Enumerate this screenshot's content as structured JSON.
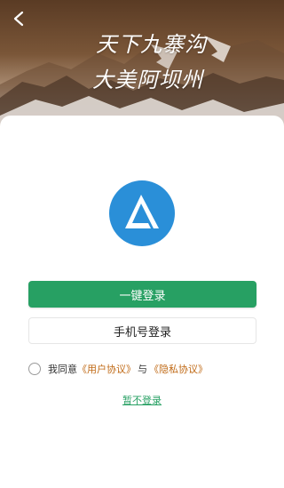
{
  "header": {
    "back_icon": "chevron-left-icon",
    "calligraphy_line1": "天下九寨沟",
    "calligraphy_line2": "大美阿坝州"
  },
  "logo": {
    "icon": "app-logo-icon",
    "color": "#2a8fd8"
  },
  "login": {
    "one_click_label": "一键登录",
    "phone_login_label": "手机号登录"
  },
  "agreement": {
    "prefix": "我同意",
    "user_agreement": "《用户协议》",
    "connector": "与",
    "privacy_agreement": "《隐私协议》",
    "checked": false
  },
  "skip": {
    "label": "暂不登录"
  },
  "colors": {
    "primary": "#27a063",
    "link": "#c06a16",
    "logo_blue": "#2a8fd8"
  }
}
